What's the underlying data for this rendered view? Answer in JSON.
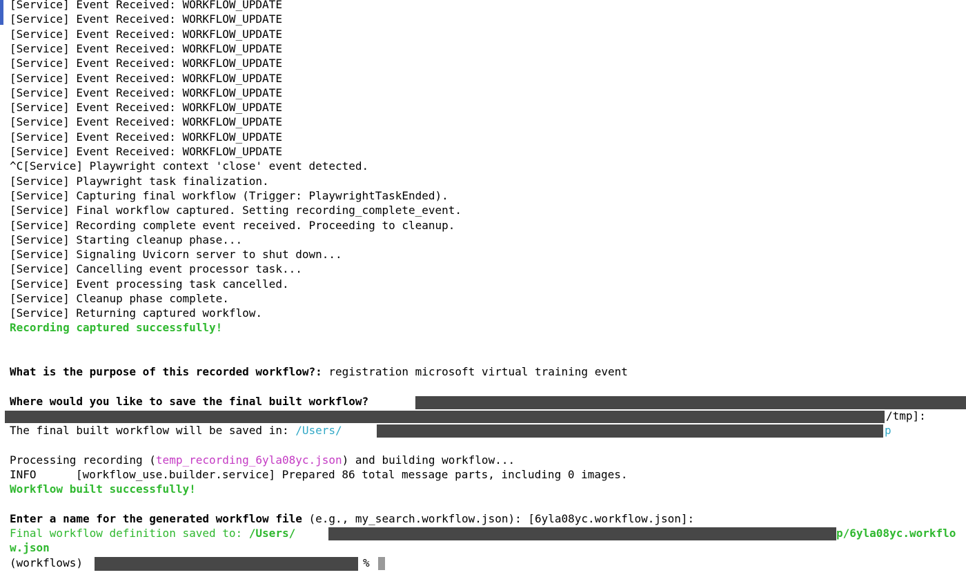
{
  "log_lines": [
    "[Service] Event Received: WORKFLOW_UPDATE",
    "[Service] Event Received: WORKFLOW_UPDATE",
    "[Service] Event Received: WORKFLOW_UPDATE",
    "[Service] Event Received: WORKFLOW_UPDATE",
    "[Service] Event Received: WORKFLOW_UPDATE",
    "[Service] Event Received: WORKFLOW_UPDATE",
    "[Service] Event Received: WORKFLOW_UPDATE",
    "[Service] Event Received: WORKFLOW_UPDATE",
    "[Service] Event Received: WORKFLOW_UPDATE",
    "[Service] Event Received: WORKFLOW_UPDATE",
    "[Service] Event Received: WORKFLOW_UPDATE",
    "^C[Service] Playwright context 'close' event detected.",
    "[Service] Playwright task finalization.",
    "[Service] Capturing final workflow (Trigger: PlaywrightTaskEnded).",
    "[Service] Final workflow captured. Setting recording_complete_event.",
    "[Service] Recording complete event received. Proceeding to cleanup.",
    "[Service] Starting cleanup phase...",
    "[Service] Signaling Uvicorn server to shut down...",
    "[Service] Cancelling event processor task...",
    "[Service] Event processing task cancelled.",
    "[Service] Cleanup phase complete.",
    "[Service] Returning captured workflow."
  ],
  "recording_success": "Recording captured successfully!",
  "purpose": {
    "question": "What is the purpose of this recorded workflow?:",
    "answer": " registration microsoft virtual training event"
  },
  "save_location": {
    "question": "Where would you like to save the final built workflow?",
    "default_suffix": "/tmp]:",
    "saved_in_label": "The final built workflow will be saved in: ",
    "saved_in_path_start": "/Users/",
    "saved_in_path_end": "p"
  },
  "processing": {
    "prefix": "Processing recording (",
    "filename": "temp_recording_6yla08yc.json",
    "suffix": ") and building workflow...",
    "info_level": "INFO",
    "info_message": "[workflow_use.builder.service] Prepared 86 total message parts, including 0 images."
  },
  "build_success": "Workflow built successfully!",
  "name_prompt": {
    "question": "Enter a name for the generated workflow file",
    "hint": " (e.g., my_search.workflow.json): [6yla08yc.workflow.json]:"
  },
  "final_saved": {
    "label": "Final workflow definition saved to: ",
    "path_start": "/Users/",
    "path_end": "p/6yla08yc.workflo",
    "path_wrap": "w.json"
  },
  "prompt": {
    "env": "(workflows)",
    "symbol": "%"
  },
  "colors": {
    "success_green": "#2fb82f",
    "path_cyan": "#31a8c6",
    "file_magenta": "#c43bc4",
    "redaction": "#474747"
  }
}
